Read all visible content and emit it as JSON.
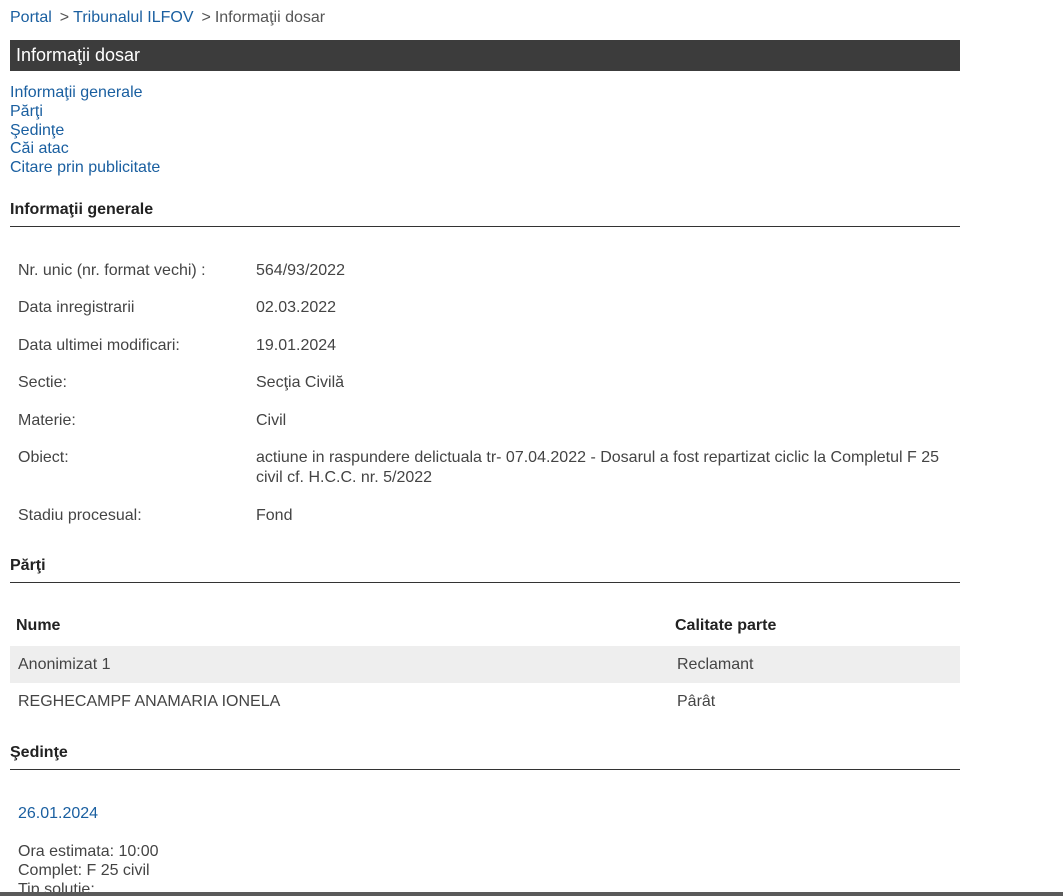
{
  "breadcrumb": {
    "items": [
      "Portal",
      "Tribunalul ILFOV"
    ],
    "separator": ">",
    "current": "Informaţii dosar"
  },
  "title": "Informaţii dosar",
  "anchor_nav": [
    "Informaţii generale",
    "Părţi",
    "Şedinţe",
    "Căi atac",
    "Citare prin publicitate"
  ],
  "sections": {
    "general": "Informaţii generale",
    "parties": "Părţi",
    "hearings": "Şedinţe"
  },
  "general_info": [
    {
      "label": "Nr. unic (nr. format vechi) :",
      "value": "564/93/2022"
    },
    {
      "label": "Data inregistrarii",
      "value": "02.03.2022"
    },
    {
      "label": "Data ultimei modificari:",
      "value": "19.01.2024"
    },
    {
      "label": "Sectie:",
      "value": "Secţia Civilă"
    },
    {
      "label": "Materie:",
      "value": "Civil"
    },
    {
      "label": "Obiect:",
      "value": "actiune in raspundere delictuala tr- 07.04.2022 - Dosarul a fost repartizat ciclic la Completul F 25 civil cf. H.C.C. nr. 5/2022"
    },
    {
      "label": "Stadiu procesual:",
      "value": "Fond"
    }
  ],
  "parties": {
    "headers": [
      "Nume",
      "Calitate parte"
    ],
    "rows": [
      {
        "name": "Anonimizat 1",
        "role": "Reclamant"
      },
      {
        "name": "REGHECAMPF ANAMARIA IONELA",
        "role": "Pârât"
      }
    ]
  },
  "hearing": {
    "date": "26.01.2024",
    "lines": [
      "Ora estimata: 10:00",
      "Complet: F 25 civil",
      "Tip solutie:"
    ]
  },
  "colors": {
    "link": "#1a5fa0",
    "title_bar": "#3c3c3c",
    "row_shade": "#eeeeee"
  }
}
